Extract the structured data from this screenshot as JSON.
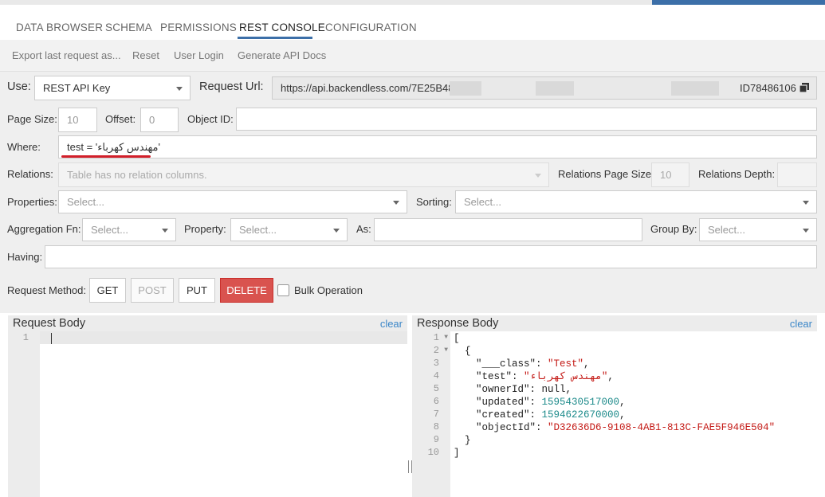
{
  "tabs": [
    "DATA BROWSER",
    "SCHEMA",
    "PERMISSIONS",
    "REST CONSOLE",
    "CONFIGURATION"
  ],
  "toolbar": [
    "Export last request as...",
    "Reset",
    "User Login",
    "Generate API Docs"
  ],
  "use": {
    "label": "Use:",
    "value": "REST API Key"
  },
  "request_url": {
    "label": "Request Url:",
    "start": "https://api.backendless.com/7E25B48",
    "end": "ID78486106"
  },
  "page_size": {
    "label": "Page Size:",
    "value": "10"
  },
  "offset": {
    "label": "Offset:",
    "value": "0"
  },
  "object_id": {
    "label": "Object ID:",
    "value": ""
  },
  "where": {
    "label": "Where:",
    "value": "test = 'مهندس كهرباء'"
  },
  "relations": {
    "label": "Relations:",
    "placeholder": "Table has no relation columns."
  },
  "relations_page_size": {
    "label": "Relations Page Size:",
    "value": "10"
  },
  "relations_depth": {
    "label": "Relations Depth:",
    "value": ""
  },
  "properties": {
    "label": "Properties:",
    "placeholder": "Select..."
  },
  "sorting": {
    "label": "Sorting:",
    "placeholder": "Select..."
  },
  "aggregation": {
    "label": "Aggregation Fn:",
    "placeholder": "Select..."
  },
  "property": {
    "label": "Property:",
    "placeholder": "Select..."
  },
  "as": {
    "label": "As:",
    "value": ""
  },
  "group_by": {
    "label": "Group By:",
    "placeholder": "Select..."
  },
  "having": {
    "label": "Having:",
    "value": ""
  },
  "request_method": {
    "label": "Request Method:",
    "buttons": [
      "GET",
      "POST",
      "PUT",
      "DELETE"
    ]
  },
  "bulk_operation": {
    "label": "Bulk Operation",
    "checked": false
  },
  "request_body": {
    "title": "Request Body",
    "clear": "clear",
    "lines": [
      "1"
    ]
  },
  "response_body": {
    "title": "Response Body",
    "clear": "clear",
    "lines": [
      "1",
      "2",
      "3",
      "4",
      "5",
      "6",
      "7",
      "8",
      "9",
      "10"
    ],
    "json": {
      "open_bracket": "[",
      "open_brace": "{",
      "class_key": "\"___class\"",
      "class_value": "\"Test\"",
      "test_key": "\"test\"",
      "test_value": "\"مهندس كهرباء\"",
      "ownerId_key": "\"ownerId\"",
      "ownerId_value": "null",
      "updated_key": "\"updated\"",
      "updated_value": "1595430517000",
      "created_key": "\"created\"",
      "created_value": "1594622670000",
      "objectId_key": "\"objectId\"",
      "objectId_value": "\"D32636D6-9108-4AB1-813C-FAE5F946E504\"",
      "close_brace": "}",
      "close_bracket": "]"
    }
  },
  "colors": {
    "accent": "#3c6fa8",
    "danger": "#d9534f",
    "link": "#3a86c8",
    "string": "#c41a16",
    "number": "#1c8a8a"
  },
  "icons": [
    "copy-icon",
    "chevron-down-icon",
    "fold-arrow-icon"
  ]
}
